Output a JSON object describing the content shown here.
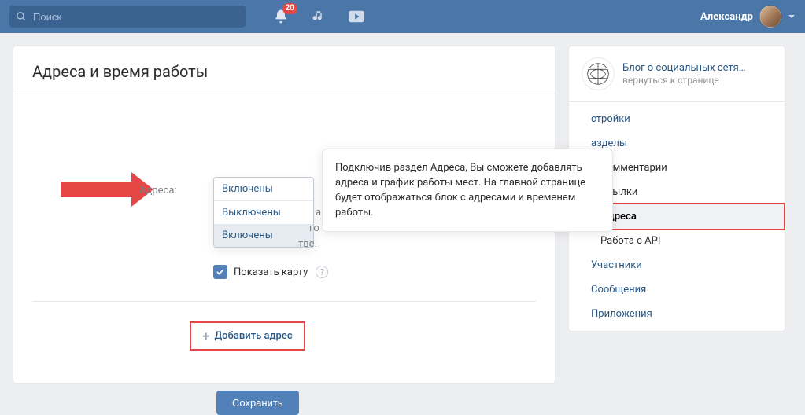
{
  "header": {
    "search_placeholder": "Поиск",
    "notifications_count": "20",
    "profile_name": "Александр"
  },
  "page": {
    "title": "Адреса и время работы"
  },
  "form": {
    "address_label": "Адреса:",
    "select_current": "Включены",
    "select_options": [
      "Выключены",
      "Включены"
    ],
    "ghost_line1": "а",
    "ghost_line2": "го",
    "ghost_line3": "тве.",
    "show_map_label": "Показать карту",
    "add_button": "Добавить адрес",
    "save_button": "Сохранить"
  },
  "tooltip": {
    "text": "Подключив раздел Адреса, Вы сможете добавлять адреса и график работы мест. На главной странице будет отображаться блок с адресами и временем работы."
  },
  "sidebar": {
    "group_title": "Блог о социальных сетя…",
    "group_sub": "вернуться к странице",
    "nav": {
      "settings_partial": "стройки",
      "sections_partial": "азделы",
      "subs": {
        "comments": "Комментарии",
        "links": "Ссылки",
        "addresses": "Адреса",
        "api": "Работа с API"
      },
      "members": "Участники",
      "messages": "Сообщения",
      "apps": "Приложения"
    }
  }
}
